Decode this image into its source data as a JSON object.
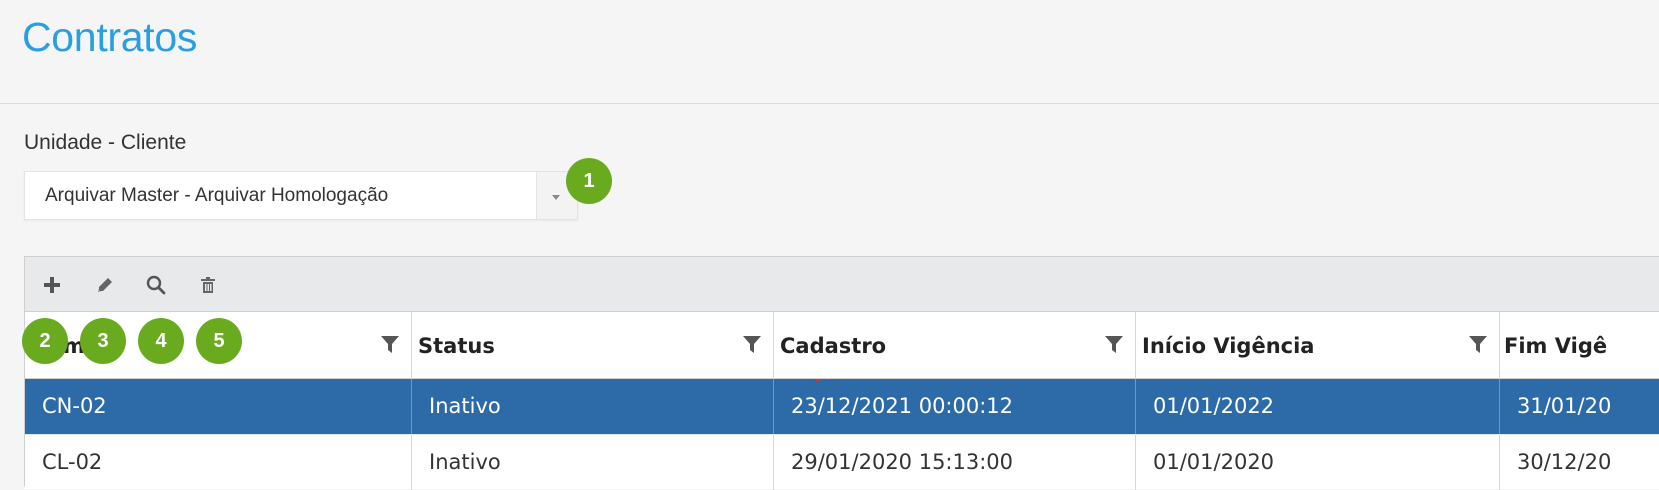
{
  "page": {
    "title": "Contratos"
  },
  "unit_field": {
    "label": "Unidade - Cliente",
    "selected": "Arquivar Master - Arquivar Homologação"
  },
  "badges": [
    "1",
    "2",
    "3",
    "4",
    "5"
  ],
  "toolbar": {
    "icons": [
      "plus-icon",
      "pencil-icon",
      "search-icon",
      "trash-icon"
    ]
  },
  "table": {
    "columns": [
      {
        "label": "Nome"
      },
      {
        "label": "Status"
      },
      {
        "label": "Cadastro"
      },
      {
        "label": "Início Vigência"
      },
      {
        "label": "Fim Vigê"
      }
    ],
    "rows": [
      {
        "nome": "CN-02",
        "status": "Inativo",
        "cadastro": "23/12/2021 00:00:12",
        "inicio": "01/01/2022",
        "fim": "31/01/20",
        "selected": true
      },
      {
        "nome": "CL-02",
        "status": "Inativo",
        "cadastro": "29/01/2020 15:13:00",
        "inicio": "01/01/2020",
        "fim": "30/12/20",
        "selected": false
      }
    ]
  },
  "colors": {
    "accent": "#2a9fe0",
    "badge": "#6aaa1f",
    "selected_row": "#2d6aa8"
  }
}
